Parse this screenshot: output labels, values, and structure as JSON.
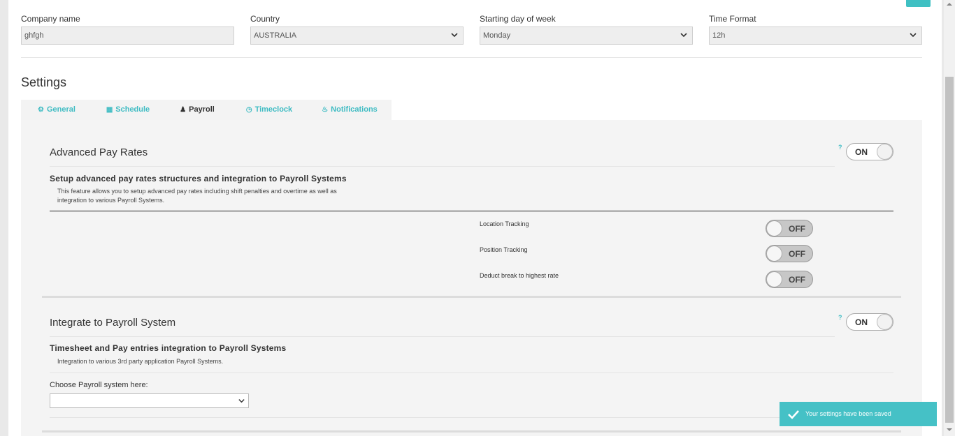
{
  "header_fields": [
    {
      "label": "Company name",
      "value": "ghfgh",
      "type": "text"
    },
    {
      "label": "Country",
      "value": "AUSTRALIA",
      "type": "select"
    },
    {
      "label": "Starting day of week",
      "value": "Monday",
      "type": "select"
    },
    {
      "label": "Time Format",
      "value": "12h",
      "type": "select"
    }
  ],
  "settings_title": "Settings",
  "tabs": [
    {
      "label": "General",
      "icon": "gear-icon",
      "active": false
    },
    {
      "label": "Schedule",
      "icon": "calendar-icon",
      "active": false
    },
    {
      "label": "Payroll",
      "icon": "user-icon",
      "active": true
    },
    {
      "label": "Timeclock",
      "icon": "clock-icon",
      "active": false
    },
    {
      "label": "Notifications",
      "icon": "bell-icon",
      "active": false
    }
  ],
  "advanced_pay_rates": {
    "title": "Advanced Pay Rates",
    "help": "?",
    "toggle": "ON",
    "subtitle": "Setup advanced pay rates structures and integration to Payroll Systems",
    "description_line1": "This feature allows you to setup advanced pay rates including shift penalties and overtime as well as",
    "description_line2": "integration to various Payroll Systems.",
    "options": [
      {
        "label": "Location Tracking",
        "toggle": "OFF"
      },
      {
        "label": "Position Tracking",
        "toggle": "OFF"
      },
      {
        "label": "Deduct break to highest rate",
        "toggle": "OFF"
      }
    ]
  },
  "payroll_integration": {
    "title": "Integrate to Payroll System",
    "help": "?",
    "toggle": "ON",
    "subtitle": "Timesheet and Pay entries integration to Payroll Systems",
    "description": "Integration to various 3rd party application Payroll Systems.",
    "select_label": "Choose Payroll system here:",
    "select_value": ""
  },
  "toast": {
    "message": "Your settings have been saved",
    "icon": "check-icon"
  },
  "colors": {
    "accent": "#3fbcc3",
    "toast": "#45c1c6",
    "panel": "#f4f4f4"
  }
}
